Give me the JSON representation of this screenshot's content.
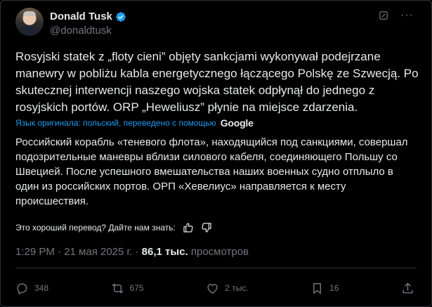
{
  "author": {
    "display_name": "Donald Tusk",
    "handle": "@donaldtusk"
  },
  "original_text": "Rosyjski statek z „floty cieni” objęty sankcjami wykonywał podejrzane manewry w pobliżu kabla energetycznego łączącego Polskę ze Szwecją. Po skutecznej interwencji naszego wojska statek odpłynął do jednego z rosyjskich portów. ORP „Heweliusz” płynie na miejsce zdarzenia.",
  "translation": {
    "label": "Язык оригинала: польский, переведено с помощью",
    "provider": "Google",
    "text": "Российский корабль «теневого флота», находящийся под санкциями, совершал подозрительные маневры вблизи силового кабеля, соединяющего Польшу со Швецией. После успешного вмешательства наших военных судно отплыло в один из российских портов. ОРП «Хевелиус» направляется к месту происшествия.",
    "feedback_prompt": "Это хороший перевод? Дайте нам знать:"
  },
  "meta": {
    "timestamp": "1:29 PM · 21 мая 2025 г. · ",
    "views_count": "86,1 тыс.",
    "views_label": " просмотров"
  },
  "actions": {
    "replies": "348",
    "reposts": "675",
    "likes": "2 тыс.",
    "bookmarks": "16"
  },
  "icons": [
    "verified-badge-icon",
    "grok-icon",
    "more-icon",
    "thumbs-up-icon",
    "thumbs-down-icon",
    "reply-icon",
    "repost-icon",
    "like-icon",
    "bookmark-icon",
    "share-icon"
  ],
  "colors": {
    "background": "#000000",
    "text": "#e7e9ea",
    "muted": "#71767b",
    "accent": "#1d9bf0"
  }
}
